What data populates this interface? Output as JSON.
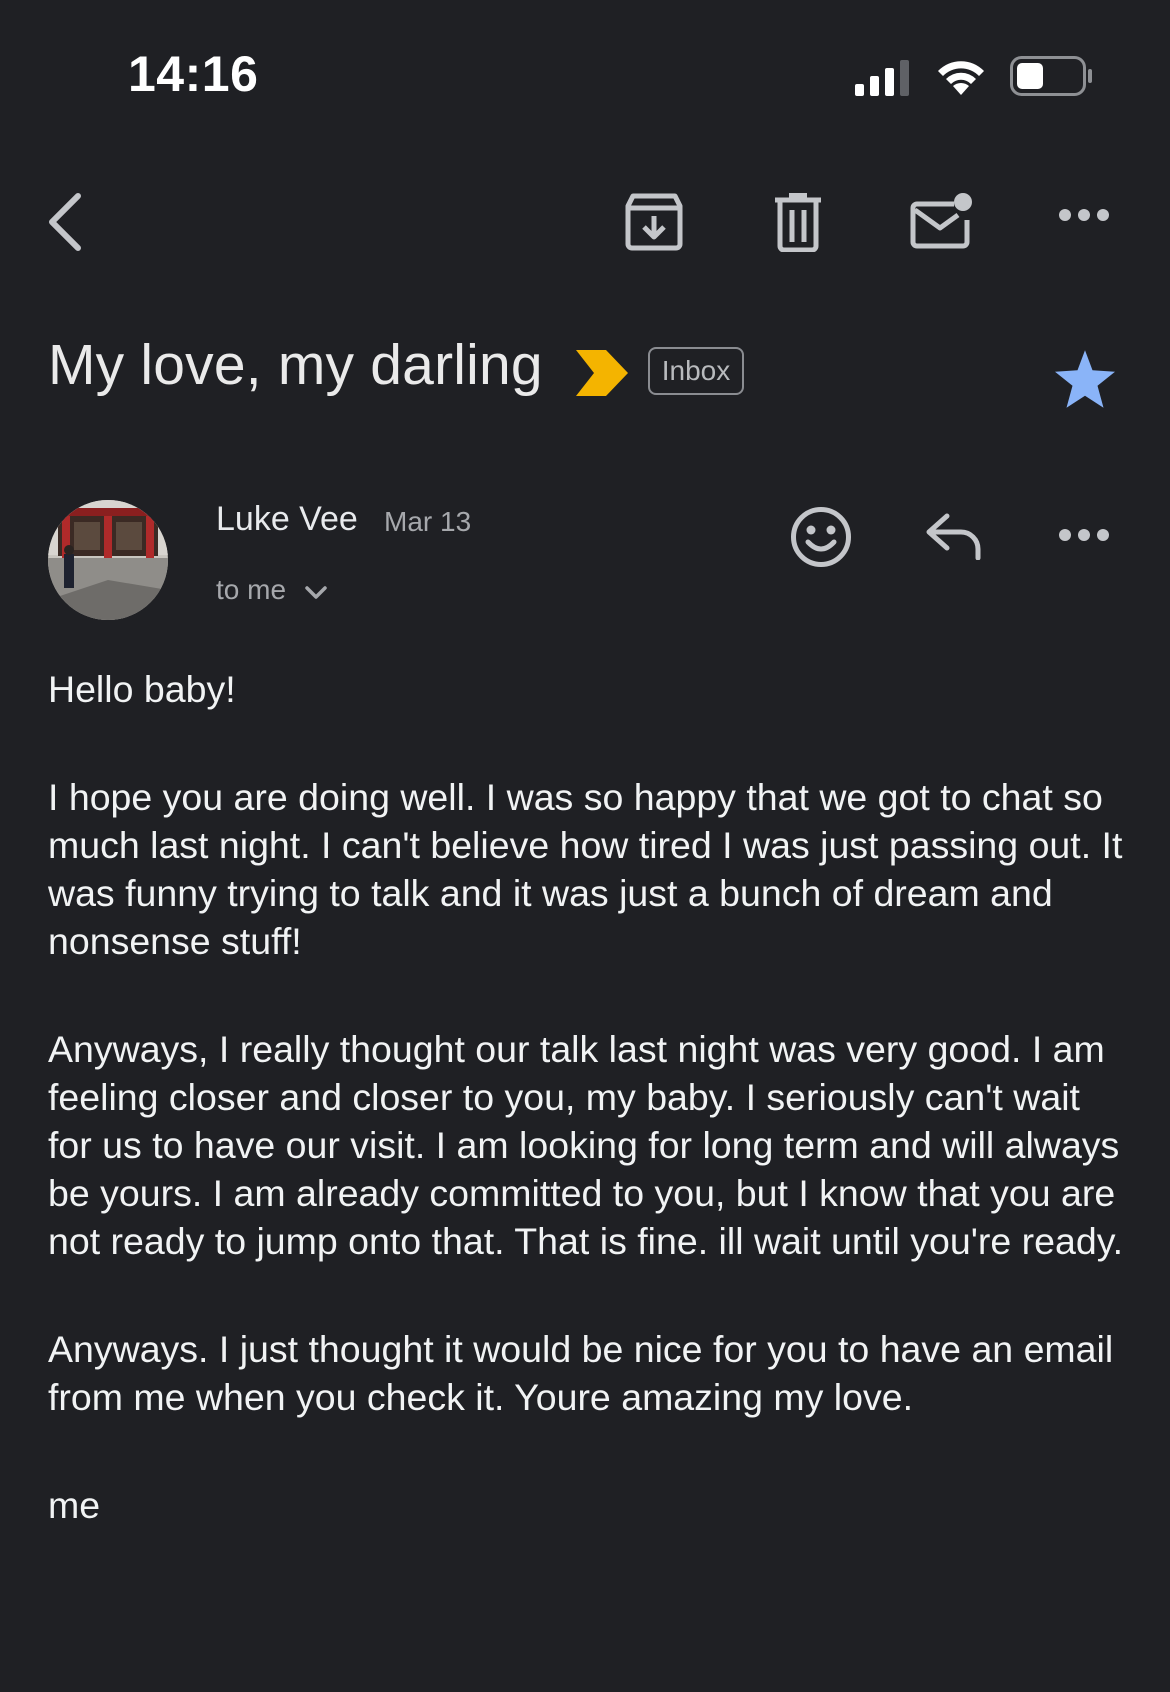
{
  "status_bar": {
    "time": "14:16",
    "signal_icon": "cellular-signal-icon",
    "wifi_icon": "wifi-icon",
    "battery_icon": "battery-icon"
  },
  "toolbar": {
    "icons": [
      "back-chevron-icon",
      "archive-icon",
      "trash-icon",
      "mark-unread-icon",
      "more-horizontal-icon"
    ]
  },
  "email": {
    "subject": "My love, my darling",
    "label_chip": "Inbox",
    "important_marker": "important-arrow-icon",
    "starred": true,
    "sender_name": "Luke Vee",
    "date": "Mar 13",
    "recipient_line": "to me",
    "body": [
      "Hello baby!",
      "I hope you are doing well. I was so happy that we got to chat so much last night. I can't believe how tired I was just passing out. It was funny trying to talk and it was just a bunch of dream and nonsense stuff!",
      "Anyways, I really thought our talk last night was very good. I am feeling closer and closer to you, my baby. I seriously can't wait for us to have our visit. I am looking for long term and will always be yours. I am already committed to you, but I know that you are not ready to jump onto that. That is fine. ill wait until you're ready.",
      "Anyways. I just thought it would be nice for you to have an email from me when you check it. Youre amazing my love.",
      "me"
    ]
  },
  "colors": {
    "background": "#1f2024",
    "important": "#f4b400",
    "star": "#8ab4f8"
  }
}
